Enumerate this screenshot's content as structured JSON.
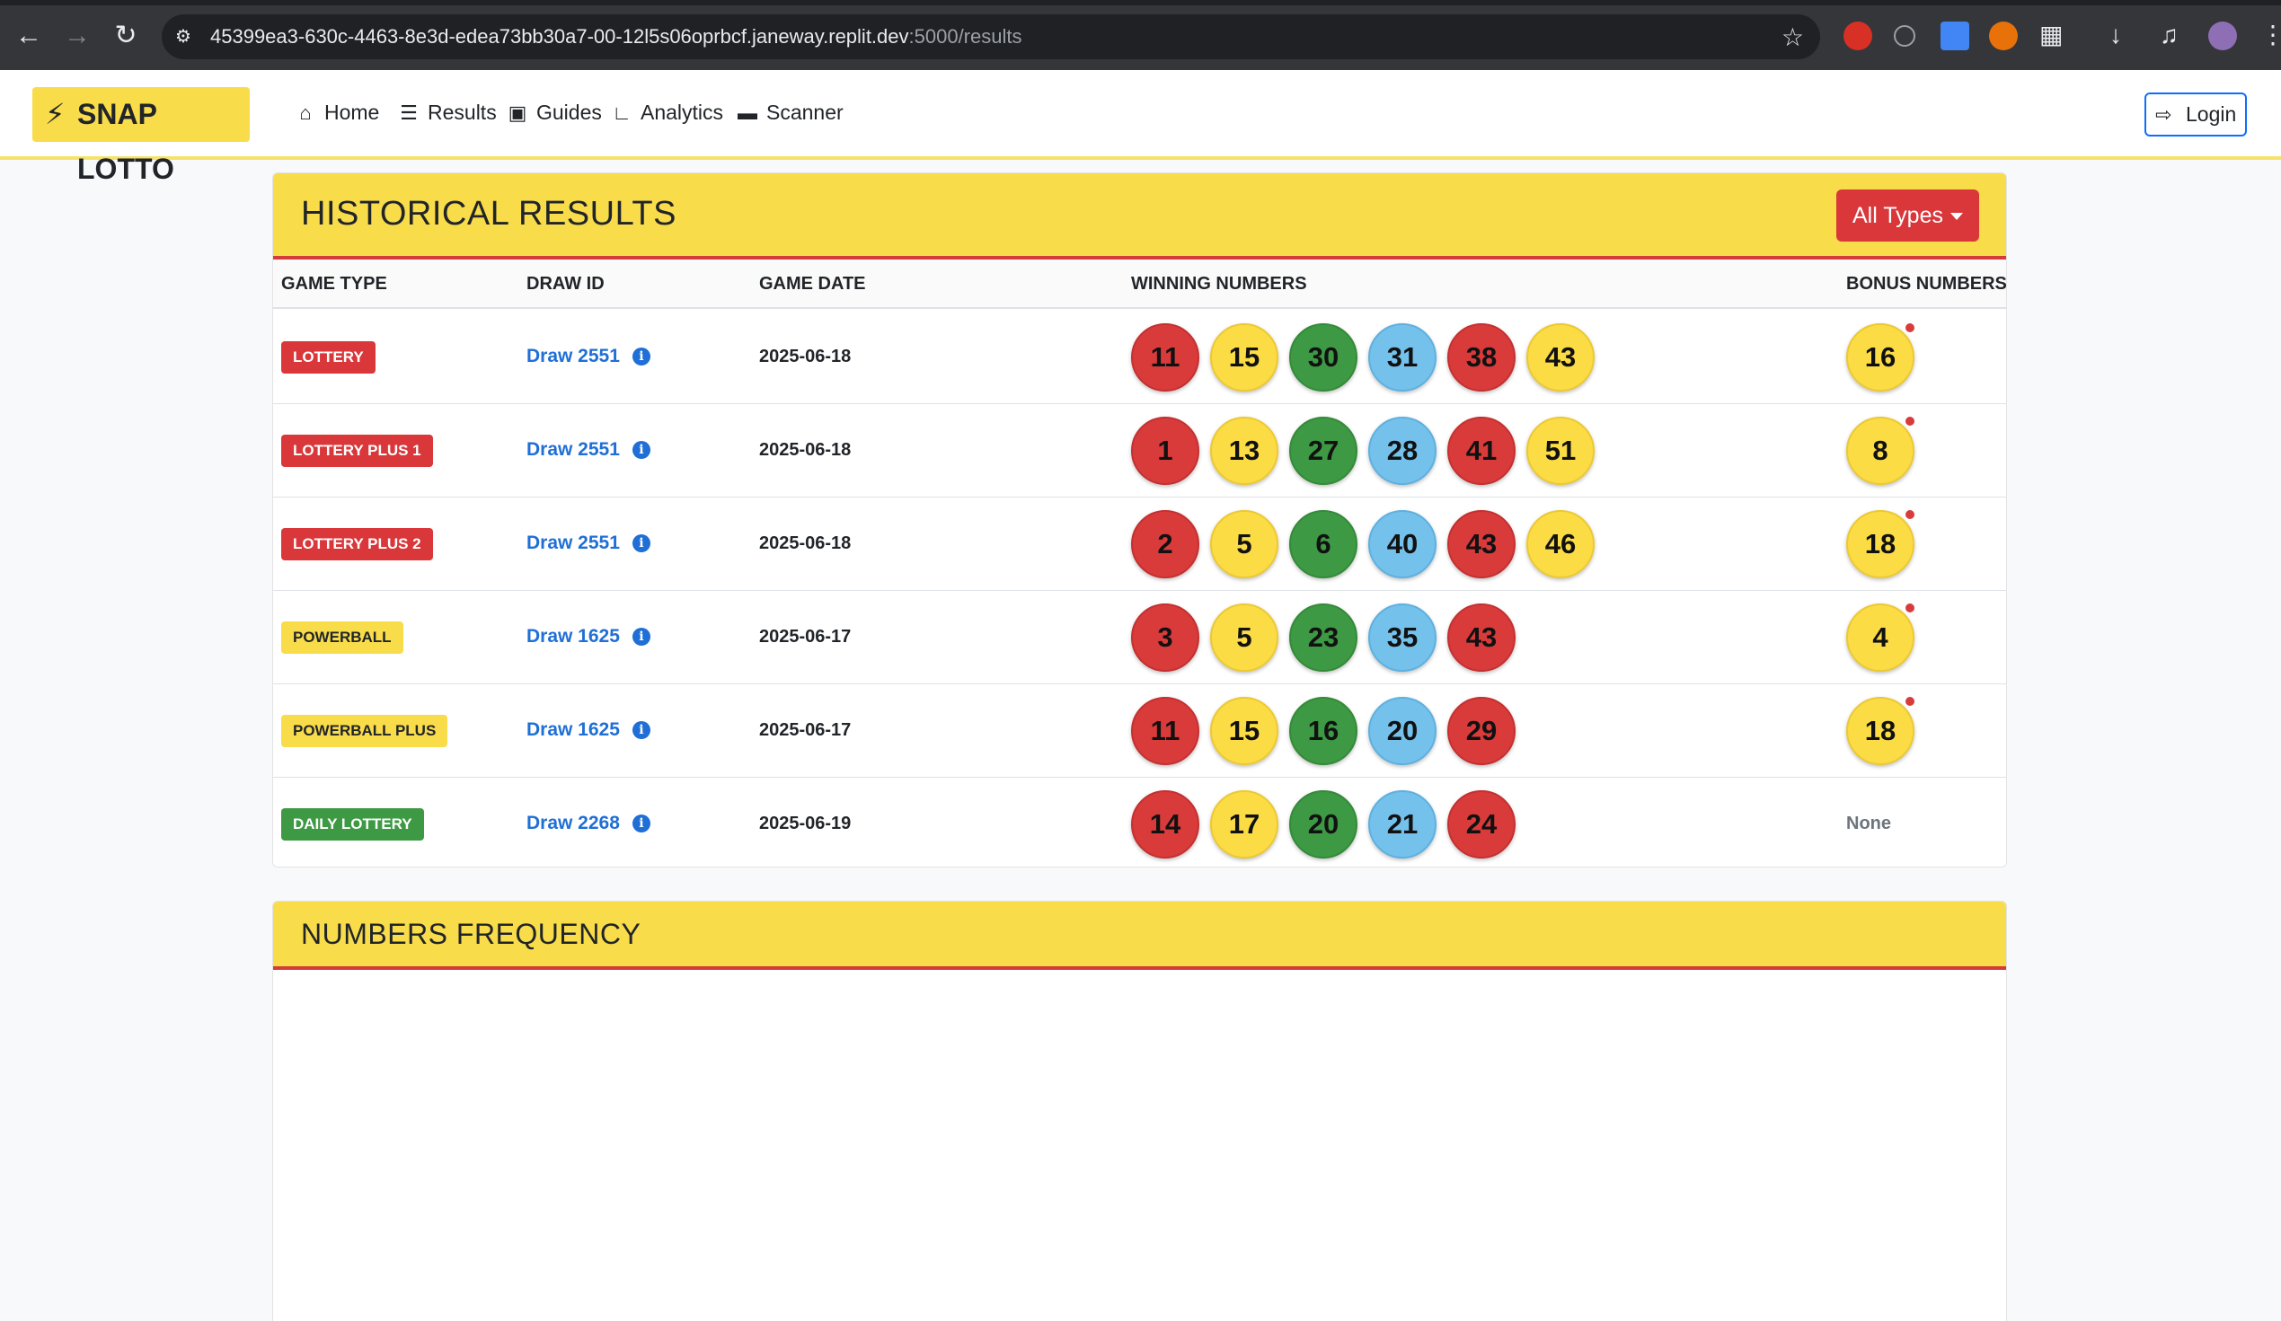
{
  "browser": {
    "url_main": "45399ea3-630c-4463-8e3d-edea73bb30a7-00-12l5s06oprbcf.janeway.replit.dev",
    "url_rest": ":5000/results"
  },
  "navbar": {
    "brand": "SNAP LOTTO",
    "links": [
      {
        "label": "Home",
        "icon": "home-icon"
      },
      {
        "label": "Results",
        "icon": "list-icon"
      },
      {
        "label": "Guides",
        "icon": "book-icon"
      },
      {
        "label": "Analytics",
        "icon": "chart-icon"
      },
      {
        "label": "Scanner",
        "icon": "ticket-icon"
      }
    ],
    "login": "Login"
  },
  "historical": {
    "title": "HISTORICAL RESULTS",
    "filter_label": "All Types",
    "columns": [
      "GAME TYPE",
      "DRAW ID",
      "GAME DATE",
      "WINNING NUMBERS",
      "BONUS NUMBERS"
    ],
    "rows": [
      {
        "game": "LOTTERY",
        "badge": "red",
        "draw": "Draw 2551",
        "date": "2025-06-18",
        "numbers": [
          [
            11,
            "red"
          ],
          [
            15,
            "yellow"
          ],
          [
            30,
            "green"
          ],
          [
            31,
            "blue"
          ],
          [
            38,
            "red"
          ],
          [
            43,
            "yellow"
          ]
        ],
        "bonus": [
          [
            16,
            "yellow"
          ]
        ]
      },
      {
        "game": "LOTTERY PLUS 1",
        "badge": "red",
        "draw": "Draw 2551",
        "date": "2025-06-18",
        "numbers": [
          [
            1,
            "red"
          ],
          [
            13,
            "yellow"
          ],
          [
            27,
            "green"
          ],
          [
            28,
            "blue"
          ],
          [
            41,
            "red"
          ],
          [
            51,
            "yellow"
          ]
        ],
        "bonus": [
          [
            8,
            "yellow"
          ]
        ]
      },
      {
        "game": "LOTTERY PLUS 2",
        "badge": "red",
        "draw": "Draw 2551",
        "date": "2025-06-18",
        "numbers": [
          [
            2,
            "red"
          ],
          [
            5,
            "yellow"
          ],
          [
            6,
            "green"
          ],
          [
            40,
            "blue"
          ],
          [
            43,
            "red"
          ],
          [
            46,
            "yellow"
          ]
        ],
        "bonus": [
          [
            18,
            "yellow"
          ]
        ]
      },
      {
        "game": "POWERBALL",
        "badge": "yellow",
        "draw": "Draw 1625",
        "date": "2025-06-17",
        "numbers": [
          [
            3,
            "red"
          ],
          [
            5,
            "yellow"
          ],
          [
            23,
            "green"
          ],
          [
            35,
            "blue"
          ],
          [
            43,
            "red"
          ]
        ],
        "bonus": [
          [
            4,
            "yellow"
          ]
        ]
      },
      {
        "game": "POWERBALL PLUS",
        "badge": "yellow",
        "draw": "Draw 1625",
        "date": "2025-06-17",
        "numbers": [
          [
            11,
            "red"
          ],
          [
            15,
            "yellow"
          ],
          [
            16,
            "green"
          ],
          [
            20,
            "blue"
          ],
          [
            29,
            "red"
          ]
        ],
        "bonus": [
          [
            18,
            "yellow"
          ]
        ]
      },
      {
        "game": "DAILY LOTTERY",
        "badge": "green",
        "draw": "Draw 2268",
        "date": "2025-06-19",
        "numbers": [
          [
            14,
            "red"
          ],
          [
            17,
            "yellow"
          ],
          [
            20,
            "green"
          ],
          [
            21,
            "blue"
          ],
          [
            24,
            "red"
          ]
        ],
        "bonus": [],
        "bonus_text": "None"
      }
    ]
  },
  "frequency": {
    "title": "NUMBERS FREQUENCY"
  },
  "colors": {
    "brand_yellow": "#f9dc4a",
    "accent_red": "#d9373a",
    "ball_green": "#3d9943",
    "ball_blue": "#74c1ec",
    "link_blue": "#1f6fd6"
  }
}
